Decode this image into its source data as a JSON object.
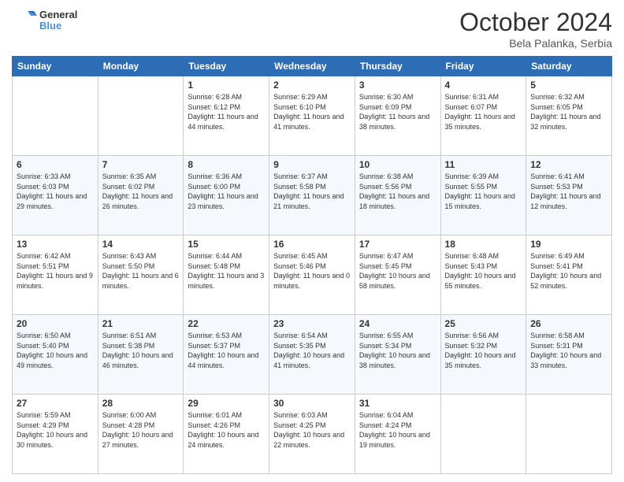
{
  "header": {
    "logo_general": "General",
    "logo_blue": "Blue",
    "month_title": "October 2024",
    "subtitle": "Bela Palanka, Serbia"
  },
  "weekdays": [
    "Sunday",
    "Monday",
    "Tuesday",
    "Wednesday",
    "Thursday",
    "Friday",
    "Saturday"
  ],
  "weeks": [
    [
      {
        "day": "",
        "info": ""
      },
      {
        "day": "",
        "info": ""
      },
      {
        "day": "1",
        "info": "Sunrise: 6:28 AM\nSunset: 6:12 PM\nDaylight: 11 hours and 44 minutes."
      },
      {
        "day": "2",
        "info": "Sunrise: 6:29 AM\nSunset: 6:10 PM\nDaylight: 11 hours and 41 minutes."
      },
      {
        "day": "3",
        "info": "Sunrise: 6:30 AM\nSunset: 6:09 PM\nDaylight: 11 hours and 38 minutes."
      },
      {
        "day": "4",
        "info": "Sunrise: 6:31 AM\nSunset: 6:07 PM\nDaylight: 11 hours and 35 minutes."
      },
      {
        "day": "5",
        "info": "Sunrise: 6:32 AM\nSunset: 6:05 PM\nDaylight: 11 hours and 32 minutes."
      }
    ],
    [
      {
        "day": "6",
        "info": "Sunrise: 6:33 AM\nSunset: 6:03 PM\nDaylight: 11 hours and 29 minutes."
      },
      {
        "day": "7",
        "info": "Sunrise: 6:35 AM\nSunset: 6:02 PM\nDaylight: 11 hours and 26 minutes."
      },
      {
        "day": "8",
        "info": "Sunrise: 6:36 AM\nSunset: 6:00 PM\nDaylight: 11 hours and 23 minutes."
      },
      {
        "day": "9",
        "info": "Sunrise: 6:37 AM\nSunset: 5:58 PM\nDaylight: 11 hours and 21 minutes."
      },
      {
        "day": "10",
        "info": "Sunrise: 6:38 AM\nSunset: 5:56 PM\nDaylight: 11 hours and 18 minutes."
      },
      {
        "day": "11",
        "info": "Sunrise: 6:39 AM\nSunset: 5:55 PM\nDaylight: 11 hours and 15 minutes."
      },
      {
        "day": "12",
        "info": "Sunrise: 6:41 AM\nSunset: 5:53 PM\nDaylight: 11 hours and 12 minutes."
      }
    ],
    [
      {
        "day": "13",
        "info": "Sunrise: 6:42 AM\nSunset: 5:51 PM\nDaylight: 11 hours and 9 minutes."
      },
      {
        "day": "14",
        "info": "Sunrise: 6:43 AM\nSunset: 5:50 PM\nDaylight: 11 hours and 6 minutes."
      },
      {
        "day": "15",
        "info": "Sunrise: 6:44 AM\nSunset: 5:48 PM\nDaylight: 11 hours and 3 minutes."
      },
      {
        "day": "16",
        "info": "Sunrise: 6:45 AM\nSunset: 5:46 PM\nDaylight: 11 hours and 0 minutes."
      },
      {
        "day": "17",
        "info": "Sunrise: 6:47 AM\nSunset: 5:45 PM\nDaylight: 10 hours and 58 minutes."
      },
      {
        "day": "18",
        "info": "Sunrise: 6:48 AM\nSunset: 5:43 PM\nDaylight: 10 hours and 55 minutes."
      },
      {
        "day": "19",
        "info": "Sunrise: 6:49 AM\nSunset: 5:41 PM\nDaylight: 10 hours and 52 minutes."
      }
    ],
    [
      {
        "day": "20",
        "info": "Sunrise: 6:50 AM\nSunset: 5:40 PM\nDaylight: 10 hours and 49 minutes."
      },
      {
        "day": "21",
        "info": "Sunrise: 6:51 AM\nSunset: 5:38 PM\nDaylight: 10 hours and 46 minutes."
      },
      {
        "day": "22",
        "info": "Sunrise: 6:53 AM\nSunset: 5:37 PM\nDaylight: 10 hours and 44 minutes."
      },
      {
        "day": "23",
        "info": "Sunrise: 6:54 AM\nSunset: 5:35 PM\nDaylight: 10 hours and 41 minutes."
      },
      {
        "day": "24",
        "info": "Sunrise: 6:55 AM\nSunset: 5:34 PM\nDaylight: 10 hours and 38 minutes."
      },
      {
        "day": "25",
        "info": "Sunrise: 6:56 AM\nSunset: 5:32 PM\nDaylight: 10 hours and 35 minutes."
      },
      {
        "day": "26",
        "info": "Sunrise: 6:58 AM\nSunset: 5:31 PM\nDaylight: 10 hours and 33 minutes."
      }
    ],
    [
      {
        "day": "27",
        "info": "Sunrise: 5:59 AM\nSunset: 4:29 PM\nDaylight: 10 hours and 30 minutes."
      },
      {
        "day": "28",
        "info": "Sunrise: 6:00 AM\nSunset: 4:28 PM\nDaylight: 10 hours and 27 minutes."
      },
      {
        "day": "29",
        "info": "Sunrise: 6:01 AM\nSunset: 4:26 PM\nDaylight: 10 hours and 24 minutes."
      },
      {
        "day": "30",
        "info": "Sunrise: 6:03 AM\nSunset: 4:25 PM\nDaylight: 10 hours and 22 minutes."
      },
      {
        "day": "31",
        "info": "Sunrise: 6:04 AM\nSunset: 4:24 PM\nDaylight: 10 hours and 19 minutes."
      },
      {
        "day": "",
        "info": ""
      },
      {
        "day": "",
        "info": ""
      }
    ]
  ]
}
